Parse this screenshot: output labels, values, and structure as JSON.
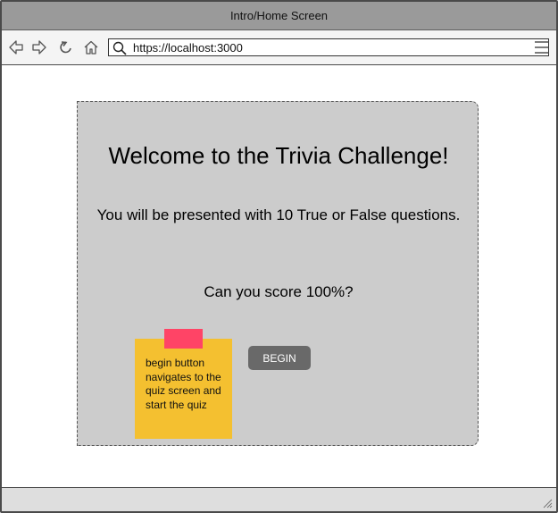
{
  "window": {
    "title": "Intro/Home Screen"
  },
  "toolbar": {
    "icons": [
      "back-icon",
      "forward-icon",
      "reload-icon",
      "home-icon",
      "search-icon",
      "menu-icon"
    ],
    "url": "https://localhost:3000"
  },
  "card": {
    "heading": "Welcome to the Trivia Challenge!",
    "subtext": "You will be presented with 10 True or False questions.",
    "question": "Can you score 100%?",
    "begin_label": "BEGIN"
  },
  "sticky_note": {
    "text": "begin button navigates to the quiz screen and start the quiz"
  },
  "colors": {
    "titlebar": "#9a9a9a",
    "card_bg": "#cccccc",
    "button_bg": "#696969",
    "sticky_bg": "#f4c030",
    "sticky_tape": "#ff4466"
  }
}
